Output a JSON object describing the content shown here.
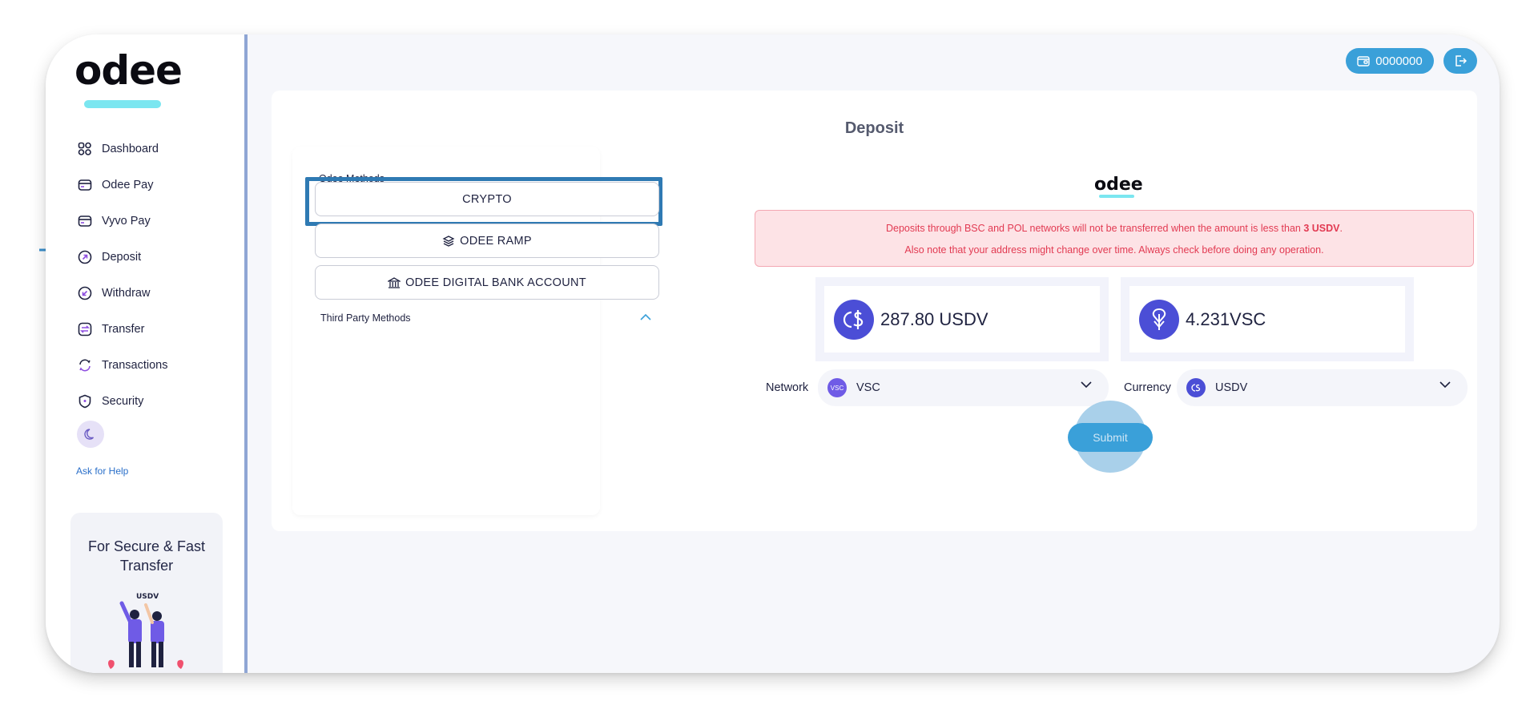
{
  "brand": {
    "logo": "odee"
  },
  "sidebar": {
    "items": [
      {
        "label": "Dashboard",
        "icon": "grid-icon"
      },
      {
        "label": "Odee Pay",
        "icon": "card-icon"
      },
      {
        "label": "Vyvo Pay",
        "icon": "card-icon"
      },
      {
        "label": "Deposit",
        "icon": "deposit-icon"
      },
      {
        "label": "Withdraw",
        "icon": "withdraw-icon"
      },
      {
        "label": "Transfer",
        "icon": "transfer-icon"
      },
      {
        "label": "Transactions",
        "icon": "refresh-icon"
      },
      {
        "label": "Security",
        "icon": "shield-icon"
      }
    ],
    "help_label": "Ask for Help",
    "promo": {
      "title": "For Secure & Fast Transfer",
      "coin_label": "USDV"
    }
  },
  "header": {
    "wallet_value": "0000000"
  },
  "deposit": {
    "title": "Deposit",
    "odee_methods_label": "Odee Methods",
    "methods": [
      {
        "label": "CRYPTO"
      },
      {
        "label": "ODEE RAMP"
      },
      {
        "label": "ODEE DIGITAL BANK ACCOUNT"
      }
    ],
    "third_party_label": "Third Party Methods",
    "brand_logo": "odee",
    "alert": {
      "line1_prefix": "Deposits through BSC and POL networks will not be transferred when the amount is less than ",
      "line1_bold": "3 USDV",
      "line1_suffix": ".",
      "line2": "Also note that your address might change over time. Always check before doing any operation."
    },
    "balances": [
      {
        "value": "287.80 USDV",
        "icon": "usdv-coin-icon"
      },
      {
        "value": "4.231VSC",
        "icon": "vsc-coin-icon"
      }
    ],
    "network": {
      "label": "Network",
      "value": "VSC",
      "badge": "VSC"
    },
    "currency": {
      "label": "Currency",
      "value": "USDV"
    },
    "submit_label": "Submit"
  },
  "colors": {
    "accent": "#3aa0d9",
    "highlight": "#2f7ab3",
    "alert_bg": "#fde3e6",
    "alert_text": "#e23a52",
    "coin": "#4b4ed6"
  }
}
